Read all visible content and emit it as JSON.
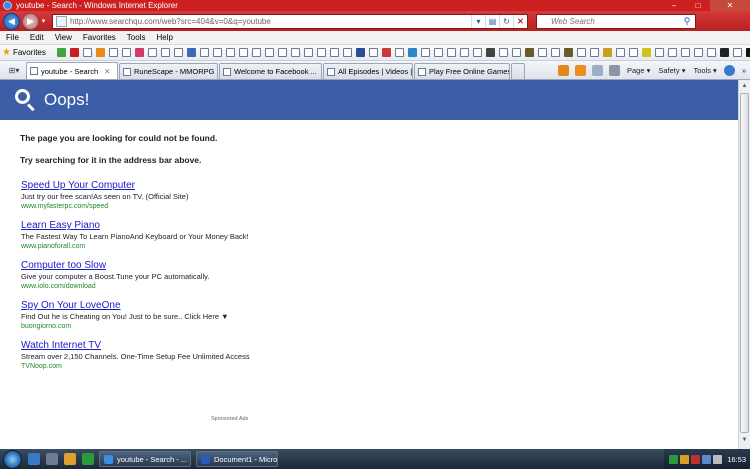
{
  "window": {
    "title": "youtube - Search - Windows Internet Explorer",
    "minimize": "–",
    "maximize": "□",
    "close": "✕"
  },
  "address": {
    "url": "http://www.searchqu.com/web?src=404&v=0&q=youtube",
    "search_placeholder": "Web Search"
  },
  "menu": [
    "File",
    "Edit",
    "View",
    "Favorites",
    "Tools",
    "Help"
  ],
  "favorites": {
    "label": "Favorites",
    "icons": [
      "green-star-icon",
      "red-square-icon",
      "page-icon",
      "flame-icon",
      "page-icon",
      "page-icon",
      "heart-icon",
      "page-icon",
      "page-icon",
      "page-icon",
      "link-icon",
      "page-icon",
      "page-icon",
      "page-icon",
      "page-icon",
      "page-icon",
      "page-icon",
      "page-icon",
      "page-icon",
      "page-icon",
      "page-icon",
      "page-icon",
      "page-icon",
      "ps-icon",
      "page-icon",
      "red-link-icon",
      "page-icon",
      "globe-icon",
      "page-icon",
      "page-icon",
      "page-icon",
      "page-icon",
      "page-icon",
      "gear-icon",
      "page-icon",
      "page-icon",
      "owl-icon",
      "page-icon",
      "page-icon",
      "owl-icon",
      "page-icon",
      "page-icon",
      "star-icon",
      "page-icon",
      "page-icon",
      "bolt-icon",
      "page-icon",
      "page-icon",
      "page-icon",
      "page-icon",
      "page-icon",
      "x-icon",
      "page-icon",
      "my-icon",
      "page-icon",
      "page-icon",
      "page-icon",
      "page-icon",
      "page-icon"
    ],
    "more": "»"
  },
  "tabs": [
    {
      "label": "youtube - Search",
      "close": "✕",
      "active": true
    },
    {
      "label": "RuneScape - MMORPG ...",
      "active": false
    },
    {
      "label": "Welcome to Facebook ...",
      "active": false
    },
    {
      "label": "All Episodes | Videos | Fr...",
      "active": false
    },
    {
      "label": "Play Free Online Games,...",
      "active": false
    }
  ],
  "command": {
    "page": "Page ▾",
    "safety": "Safety ▾",
    "tools": "Tools ▾",
    "more": "»"
  },
  "page": {
    "banner": "Oops!",
    "message1": "The page you are looking for could not be found.",
    "message2": "Try searching for it in the address bar above.",
    "ads": [
      {
        "title": "Speed Up Your Computer",
        "desc": "Just try our free scan!As seen on TV. (Official Site)",
        "url": "www.myfasterpc.com/speed"
      },
      {
        "title": "Learn Easy Piano",
        "desc": "The Fastest Way To Learn PianoAnd Keyboard or Your Money Back!",
        "url": "www.pianoforall.com"
      },
      {
        "title": "Computer too Slow",
        "desc": "Give your computer a Boost.Tune your PC automatically.",
        "url": "www.iolo.com/download"
      },
      {
        "title": "Spy On Your LoveOne",
        "desc": "Find Out he is Cheating on You! Just to be sure.. Click Here ▼",
        "url": "buongiorno.com"
      },
      {
        "title": "Watch Internet TV",
        "desc": "Stream over 2,150 Channels. One-Time Setup Fee Unlimited Access",
        "url": "TVNoop.com"
      }
    ],
    "sponsored": "Sponsored Ads"
  },
  "taskbar": {
    "buttons": [
      {
        "label": "youtube - Search - ..."
      },
      {
        "label": "Document1 - Micro..."
      }
    ],
    "clock": "16:53"
  }
}
